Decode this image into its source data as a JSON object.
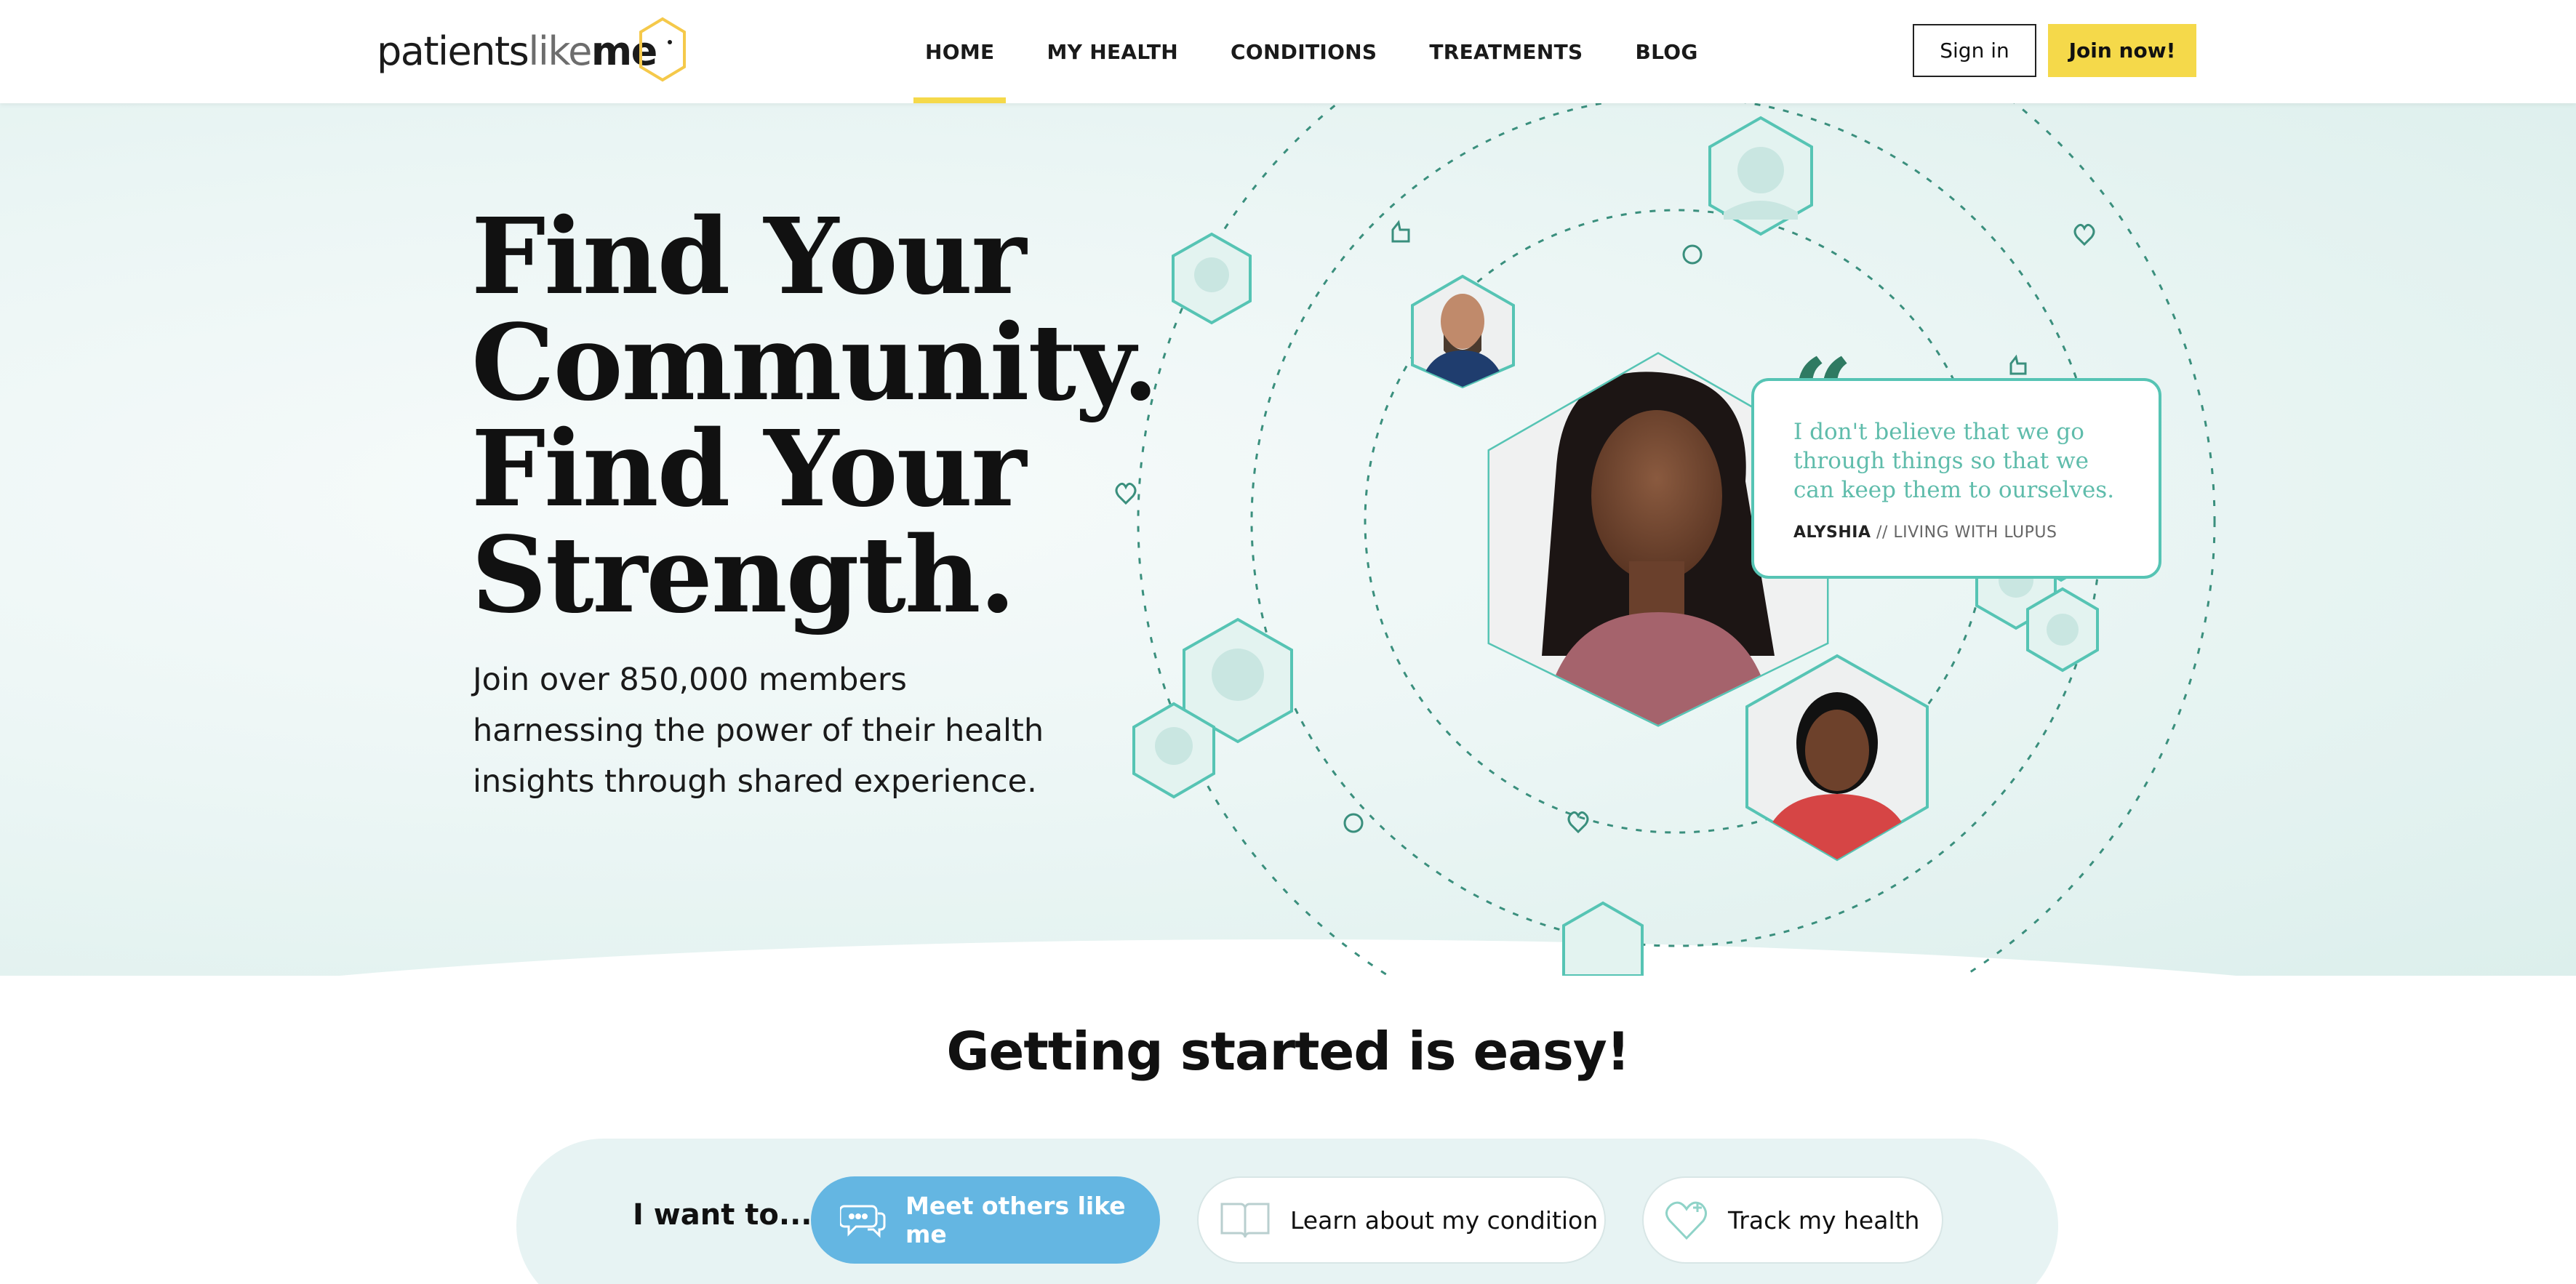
{
  "header": {
    "logo": {
      "part1": "patients",
      "part2": "like",
      "part3": "me"
    },
    "nav": [
      {
        "label": "HOME",
        "active": true
      },
      {
        "label": "MY HEALTH",
        "active": false
      },
      {
        "label": "CONDITIONS",
        "active": false
      },
      {
        "label": "TREATMENTS",
        "active": false
      },
      {
        "label": "BLOG",
        "active": false
      }
    ],
    "signin_label": "Sign in",
    "join_label": "Join now!"
  },
  "hero": {
    "title_lines": [
      "Find Your",
      "Community.",
      "Find Your",
      "Strength."
    ],
    "subtitle": "Join over 850,000 members harnessing the power of their health insights through shared experience.",
    "quote": {
      "text": "I don't believe that  we go through things so that we can keep them to ourselves.",
      "author_name": "ALYSHIA",
      "author_detail": "// LIVING WITH LUPUS"
    },
    "carousel": {
      "slides": 3,
      "active": 1
    }
  },
  "getting_started": {
    "title": "Getting started is easy!",
    "prompt": "I want to...",
    "options": [
      {
        "label": "Meet others like me",
        "icon": "chat-bubbles-icon",
        "selected": true
      },
      {
        "label": "Learn about my condition",
        "icon": "open-book-icon",
        "selected": false
      },
      {
        "label": "Track my health",
        "icon": "heart-plus-icon",
        "selected": false
      }
    ]
  },
  "colors": {
    "accent_yellow": "#f5d94a",
    "teal": "#56c4b4",
    "dark_green_quote": "#2f7a62",
    "button_blue": "#64b6e2"
  }
}
